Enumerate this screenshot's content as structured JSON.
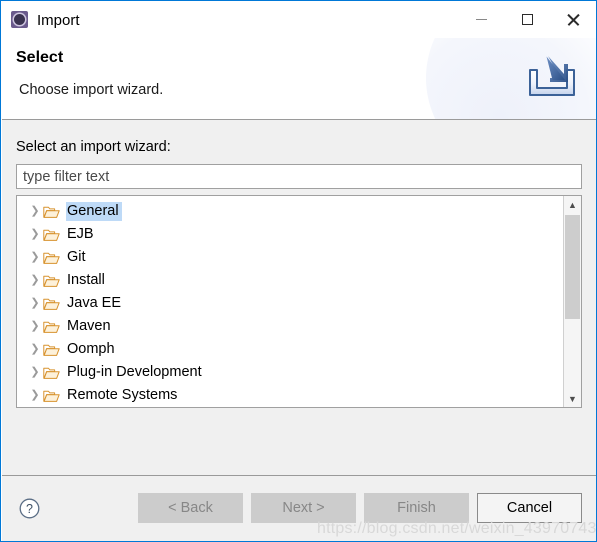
{
  "window": {
    "title": "Import",
    "icon": "eclipse-wizard-icon",
    "controls": {
      "minimize": "minimize-icon",
      "maximize": "maximize-icon",
      "close": "close-icon"
    }
  },
  "header": {
    "title": "Select",
    "subtitle": "Choose import wizard.",
    "banner_icon": "import-tray-arrow-icon"
  },
  "main": {
    "label": "Select an import wizard:",
    "filter": {
      "value": "",
      "placeholder": "type filter text"
    },
    "tree": {
      "selected": "General",
      "items": [
        {
          "label": "General",
          "icon": "folder-icon",
          "expander": "chevron-right-icon",
          "selected": true
        },
        {
          "label": "EJB",
          "icon": "folder-icon",
          "expander": "chevron-right-icon",
          "selected": false
        },
        {
          "label": "Git",
          "icon": "folder-icon",
          "expander": "chevron-right-icon",
          "selected": false
        },
        {
          "label": "Install",
          "icon": "folder-icon",
          "expander": "chevron-right-icon",
          "selected": false
        },
        {
          "label": "Java EE",
          "icon": "folder-icon",
          "expander": "chevron-right-icon",
          "selected": false
        },
        {
          "label": "Maven",
          "icon": "folder-icon",
          "expander": "chevron-right-icon",
          "selected": false
        },
        {
          "label": "Oomph",
          "icon": "folder-icon",
          "expander": "chevron-right-icon",
          "selected": false
        },
        {
          "label": "Plug-in Development",
          "icon": "folder-icon",
          "expander": "chevron-right-icon",
          "selected": false
        },
        {
          "label": "Remote Systems",
          "icon": "folder-icon",
          "expander": "chevron-right-icon",
          "selected": false
        }
      ]
    },
    "scrollbar": {
      "up_arrow": "chevron-up-icon",
      "down_arrow": "chevron-down-icon"
    }
  },
  "footer": {
    "help_icon": "help-question-icon",
    "buttons": [
      {
        "label": "< Back",
        "enabled": false
      },
      {
        "label": "Next >",
        "enabled": false
      },
      {
        "label": "Finish",
        "enabled": false
      },
      {
        "label": "Cancel",
        "enabled": true
      }
    ]
  },
  "watermark": "https://blog.csdn.net/weixin_43970743",
  "colors": {
    "dialog_border": "#0078d7",
    "selection": "#bedaf7",
    "body_background": "#f0f0f0",
    "folder": "#e8a33d",
    "disabled_button": "#cccccc"
  }
}
